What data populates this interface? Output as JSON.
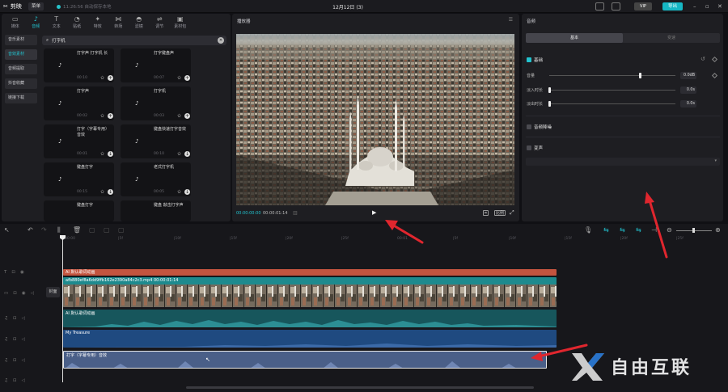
{
  "app": {
    "name": "剪映",
    "menu_label": "菜单",
    "autosave": "11:26:56 自动保存本地",
    "doc_title": "12月12日 (3)",
    "vip": "VIP",
    "export": "导出"
  },
  "media_tabs": [
    {
      "label": "媒体",
      "glyph": "▭"
    },
    {
      "label": "音频",
      "glyph": "♪"
    },
    {
      "label": "文本",
      "glyph": "T"
    },
    {
      "label": "贴纸",
      "glyph": "◔"
    },
    {
      "label": "特效",
      "glyph": "✦"
    },
    {
      "label": "转场",
      "glyph": "⋈"
    },
    {
      "label": "滤镜",
      "glyph": "◓"
    },
    {
      "label": "调节",
      "glyph": "⇌"
    },
    {
      "label": "素材包",
      "glyph": "▣"
    }
  ],
  "media_side": [
    "音乐素材",
    "音效素材",
    "音频提取",
    "抖音收藏",
    "链接下载"
  ],
  "search": {
    "value": "打字机"
  },
  "sound_cards": [
    {
      "title": "打字声 打字机 长",
      "duration": "00:10"
    },
    {
      "title": "打字键盘声",
      "duration": "00:07"
    },
    {
      "title": "打字声",
      "duration": "00:02"
    },
    {
      "title": "打字机",
      "duration": "00:03"
    },
    {
      "title": "打字（字幕专用）音效",
      "duration": "00:01"
    },
    {
      "title": "键盘快速打字音效",
      "duration": "00:10"
    },
    {
      "title": "键盘打字",
      "duration": "00:15"
    },
    {
      "title": "老式打字机",
      "duration": "00:05"
    },
    {
      "title": "键盘打字",
      "duration": ""
    },
    {
      "title": "键盘 敲击打字声",
      "duration": ""
    }
  ],
  "player": {
    "title": "播放器",
    "time_current": "00:00:00:00",
    "time_total": "00:00:01:14",
    "ratio_label": "比例"
  },
  "props": {
    "title": "音频",
    "tab_basic": "基本",
    "tab_speed": "变速",
    "section_basic": "基础",
    "volume_label": "音量",
    "volume_value": "0.0dB",
    "fade_in_label": "淡入时长",
    "fade_in_value": "0.0s",
    "fade_out_label": "淡出时长",
    "fade_out_value": "0.0s",
    "normalize_label": "音频降噪",
    "voice_change_label": "变声"
  },
  "ruler_ticks": [
    "00:00",
    "|5f",
    "|10f",
    "|15f",
    "|20f",
    "|25f",
    "00:01",
    "|5f",
    "|10f",
    "|15f",
    "|20f",
    "|25f"
  ],
  "tracks": {
    "cover_label": "封面",
    "text_clip": "AI 默认歌词动画",
    "video_clip": "afb880ef8a6dd9ffb162e2390a84c2c3.mp4   00:00:01:14",
    "audio1_clip": "AI 默认歌词动画",
    "audio2_clip": "My Treasure",
    "audio3_clip": "打字（字幕专用）音效"
  },
  "watermark": "自由互联",
  "colors": {
    "accent": "#22c3cf",
    "text_clip": "#c3543f",
    "video_clip": "#1e8a8e",
    "audio1": "#17565c",
    "audio2": "#1f4a80",
    "audio3": "#4a5f88",
    "arrow": "#e0262e"
  }
}
